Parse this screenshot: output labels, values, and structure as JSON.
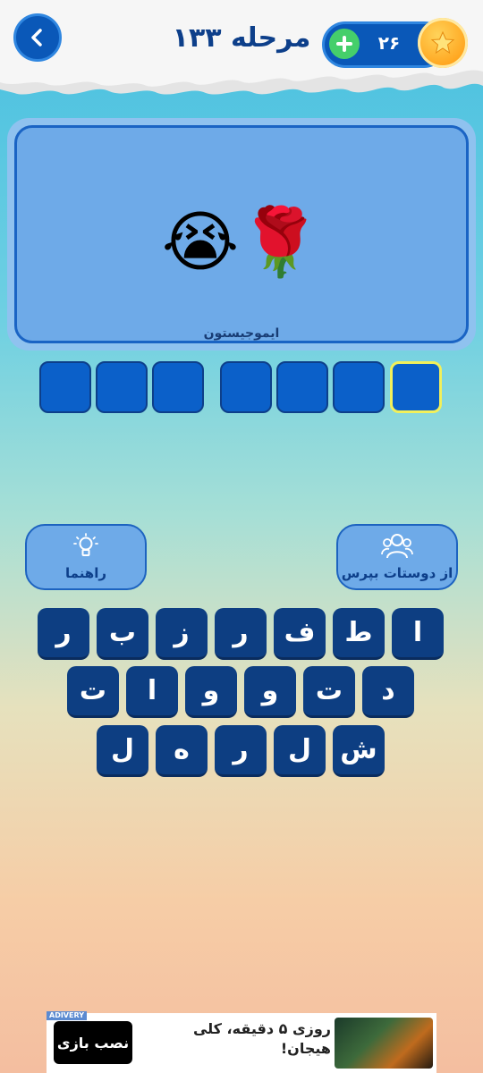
{
  "header": {
    "level_title": "مرحله ۱۳۳",
    "coins": "۲۶"
  },
  "puzzle": {
    "emojis": "😭🌹",
    "caption": "ایموجیستون"
  },
  "answer": {
    "word1_length": 4,
    "word2_length": 3
  },
  "helpers": {
    "ask_friends": "از دوستات بپرس",
    "hint": "راهنما"
  },
  "keyboard": {
    "row1": [
      "ا",
      "ط",
      "ف",
      "ر",
      "ز",
      "ب",
      "ر"
    ],
    "row2": [
      "د",
      "ت",
      "و",
      "و",
      "ا",
      "ت"
    ],
    "row3": [
      "ش",
      "ل",
      "ر",
      "ه",
      "ل"
    ]
  },
  "ad": {
    "tag": "ADIVERY",
    "text": "روزی ۵ دقیقه، کلی هیجان!",
    "install": "نصب بازی"
  },
  "colors": {
    "key": "#0d3e82",
    "slot": "#0b60c9",
    "active_slot_border": "#f2f05a",
    "card": "#6eaae8",
    "title": "#0d3f8a"
  }
}
